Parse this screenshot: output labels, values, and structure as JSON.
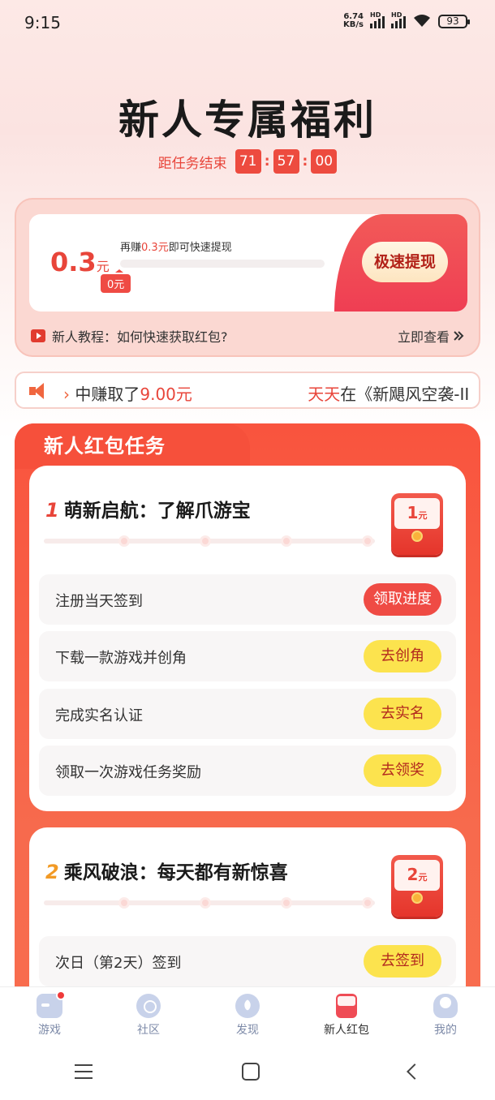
{
  "status_bar": {
    "time": "9:15",
    "net_speed_value": "6.74",
    "net_speed_unit": "KB/s",
    "hd": "HD",
    "battery": "93"
  },
  "header": {
    "title": "新人专属福利"
  },
  "countdown": {
    "label": "距任务结束",
    "hours": "71",
    "minutes": "57",
    "seconds": "00",
    "separator": ":"
  },
  "wallet": {
    "amount": "0.3",
    "unit": "元",
    "hint_prefix": "再赚",
    "hint_amount": "0.3元",
    "hint_suffix": "即可快速提现",
    "progress_fraction": 0,
    "current_tag": "0元",
    "withdraw_label": "极速提现"
  },
  "tutorial": {
    "text": "新人教程：如何快速获取红包?",
    "view_label": "立即查看"
  },
  "marquee": {
    "part1": "中赚取了",
    "amount": "9.00元",
    "user": "天天",
    "part2": "在《新飓风空袭-II"
  },
  "tasks_section": {
    "title": "新人红包任务"
  },
  "stage1": {
    "num": "1",
    "title": "萌新启航：了解爪游宝",
    "reward_value": "1",
    "reward_unit": "元",
    "steps_done": 0,
    "steps_total": 4,
    "tasks": [
      {
        "label": "注册当天签到",
        "button": "领取进度"
      },
      {
        "label": "下载一款游戏并创角",
        "button": "去创角"
      },
      {
        "label": "完成实名认证",
        "button": "去实名"
      },
      {
        "label": "领取一次游戏任务奖励",
        "button": "去领奖"
      }
    ]
  },
  "stage2": {
    "num": "2",
    "title": "乘风破浪：每天都有新惊喜",
    "reward_value": "2",
    "reward_unit": "元",
    "steps_done": 0,
    "steps_total": 4,
    "tasks": [
      {
        "label": "次日（第2天）签到",
        "button": "去签到"
      }
    ]
  },
  "bottom_nav": [
    {
      "label": "游戏",
      "icon": "gamepad-icon"
    },
    {
      "label": "社区",
      "icon": "community-icon"
    },
    {
      "label": "发现",
      "icon": "compass-icon"
    },
    {
      "label": "新人红包",
      "icon": "red-envelope-icon",
      "active": true
    },
    {
      "label": "我的",
      "icon": "profile-icon"
    }
  ],
  "colors": {
    "accent_red": "#e8453a",
    "button_yellow": "#fce34e",
    "section_orange": "#f9543e"
  }
}
